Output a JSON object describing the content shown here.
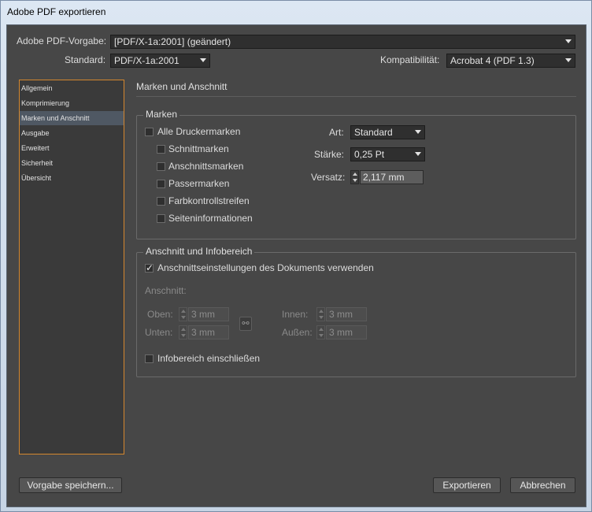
{
  "window": {
    "title": "Adobe PDF exportieren"
  },
  "header": {
    "preset_label": "Adobe PDF-Vorgabe:",
    "preset_value": "[PDF/X-1a:2001] (geändert)",
    "standard_label": "Standard:",
    "standard_value": "PDF/X-1a:2001",
    "compat_label": "Kompatibilität:",
    "compat_value": "Acrobat 4 (PDF 1.3)"
  },
  "sidebar": {
    "items": [
      {
        "label": "Allgemein",
        "selected": false
      },
      {
        "label": "Komprimierung",
        "selected": false
      },
      {
        "label": "Marken und Anschnitt",
        "selected": true
      },
      {
        "label": "Ausgabe",
        "selected": false
      },
      {
        "label": "Erweitert",
        "selected": false
      },
      {
        "label": "Sicherheit",
        "selected": false
      },
      {
        "label": "Übersicht",
        "selected": false
      }
    ]
  },
  "main": {
    "title": "Marken und Anschnitt",
    "marks": {
      "group_label": "Marken",
      "all": {
        "label": "Alle Druckermarken",
        "checked": false
      },
      "items": [
        {
          "label": "Schnittmarken",
          "checked": false
        },
        {
          "label": "Anschnittsmarken",
          "checked": false
        },
        {
          "label": "Passermarken",
          "checked": false
        },
        {
          "label": "Farbkontrollstreifen",
          "checked": false
        },
        {
          "label": "Seiteninformationen",
          "checked": false
        }
      ],
      "type_label": "Art:",
      "type_value": "Standard",
      "weight_label": "Stärke:",
      "weight_value": "0,25 Pt",
      "offset_label": "Versatz:",
      "offset_value": "2,117 mm"
    },
    "bleed": {
      "group_label": "Anschnitt und Infobereich",
      "use_doc": {
        "label": "Anschnittseinstellungen des Dokuments verwenden",
        "checked": true
      },
      "bleed_label": "Anschnitt:",
      "top_label": "Oben:",
      "top_value": "3 mm",
      "bottom_label": "Unten:",
      "bottom_value": "3 mm",
      "inside_label": "Innen:",
      "inside_value": "3 mm",
      "outside_label": "Außen:",
      "outside_value": "3 mm",
      "slug": {
        "label": "Infobereich einschließen",
        "checked": false
      }
    }
  },
  "footer": {
    "save_preset": "Vorgabe speichern...",
    "export": "Exportieren",
    "cancel": "Abbrechen"
  }
}
